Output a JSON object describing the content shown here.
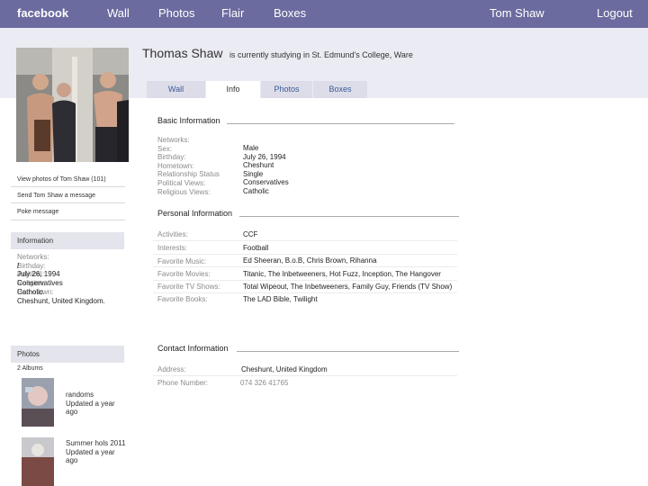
{
  "nav": {
    "brand": "facebook",
    "wall": "Wall",
    "photos": "Photos",
    "flair": "Flair",
    "boxes": "Boxes",
    "user": "Tom Shaw",
    "logout": "Logout"
  },
  "profile": {
    "name": "Thomas Shaw",
    "status": "is currently studying in St. Edmund's College, Ware"
  },
  "tabs": [
    "Wall",
    "Info",
    "Photos",
    "Boxes"
  ],
  "sidebar": {
    "view_photos": "View photos of Tom Shaw (101)",
    "send_message": "Send Tom Shaw a message",
    "poke": "Poke message",
    "information_header": "Information",
    "info": [
      {
        "label": "Networks:",
        "value": "/"
      },
      {
        "label": "Birthday:",
        "value": "July 26, 1994"
      },
      {
        "label": "Political:",
        "value": "Conservatives"
      },
      {
        "label": "Religion:",
        "value": "Catholic"
      },
      {
        "label": "Hometown:",
        "value": "Cheshunt, United Kingdom."
      }
    ],
    "photos_header": "Photos",
    "albums_count": "2 Albums",
    "albums": [
      {
        "title": "randoms",
        "updated": "Updated a year ago"
      },
      {
        "title": "Summer hols 2011",
        "updated": "Updated a year ago"
      }
    ]
  },
  "basic": {
    "title": "Basic Information",
    "labels": [
      "Networks:",
      "Sex:",
      "Birthday:",
      "Hometown:",
      "Relationship Status",
      "Political Views:",
      "Religious Views:"
    ],
    "values": [
      "Male",
      "July 26, 1994",
      "Cheshunt",
      "Single",
      "Conservatives",
      "Catholic"
    ]
  },
  "personal": {
    "title": "Personal Information",
    "rows": [
      {
        "label": "Activities:",
        "value": "CCF"
      },
      {
        "label": "Interests:",
        "value": "Football"
      },
      {
        "label": "Favorite Music:",
        "value": "Ed Sheeran, B.o.B, Chris Brown, Rihanna"
      },
      {
        "label": "Favorite Movies:",
        "value": "Titanic, The Inbetweeners, Hot Fuzz, Inception, The Hangover"
      },
      {
        "label": "Favorite TV Shows:",
        "value": "Total Wipeout, The Inbetweeners, Family Guy, Friends (TV Show)"
      },
      {
        "label": "Favorite Books:",
        "value": "The LAD Bible, Twilight"
      }
    ]
  },
  "contact": {
    "title": "Contact Information",
    "address_label": "Address:",
    "address_value": "Cheshunt, United Kingdom",
    "phone_label": "Phone Number:",
    "phone_value": "074 326 41765"
  }
}
